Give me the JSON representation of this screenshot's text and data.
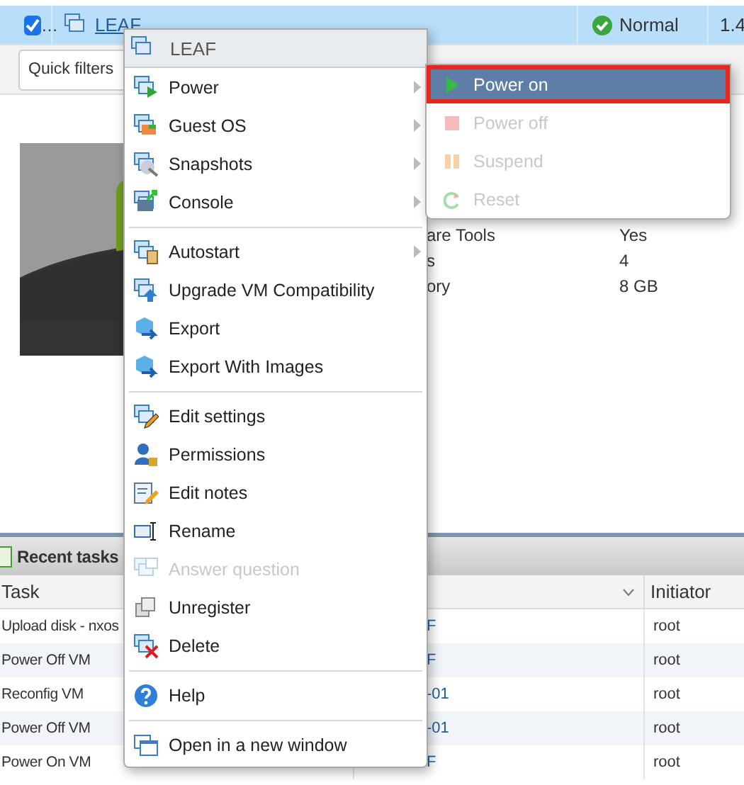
{
  "vm_row": {
    "checked": true,
    "overflow": "…",
    "name": "LEAF",
    "status": "Normal",
    "column_4": "1.4"
  },
  "toolbar": {
    "quick_filters": "Quick filters"
  },
  "properties": [
    {
      "label": "are Tools",
      "value": "Yes"
    },
    {
      "label": "s",
      "value": "4"
    },
    {
      "label": "ory",
      "value": "8 GB"
    }
  ],
  "recent_tasks": {
    "title": "Recent tasks",
    "columns": {
      "task": "Task",
      "initiator": "Initiator"
    },
    "rows": [
      {
        "task": "Upload disk - nxos",
        "target": "F",
        "initiator": "root"
      },
      {
        "task": "Power Off VM",
        "target": "F",
        "initiator": "root"
      },
      {
        "task": "Reconfig VM",
        "target": "-01",
        "initiator": "root"
      },
      {
        "task": "Power Off VM",
        "target": "-01",
        "initiator": "root"
      },
      {
        "task": "Power On VM",
        "target": "F",
        "initiator": "root"
      }
    ]
  },
  "context_menu": {
    "title": "LEAF",
    "groups": [
      [
        {
          "label": "Power",
          "submenu": true,
          "disabled": false
        },
        {
          "label": "Guest OS",
          "submenu": true,
          "disabled": false
        },
        {
          "label": "Snapshots",
          "submenu": true,
          "disabled": false
        },
        {
          "label": "Console",
          "submenu": true,
          "disabled": false
        }
      ],
      [
        {
          "label": "Autostart",
          "submenu": true,
          "disabled": false
        },
        {
          "label": "Upgrade VM Compatibility",
          "submenu": false,
          "disabled": false
        },
        {
          "label": "Export",
          "submenu": false,
          "disabled": false
        },
        {
          "label": "Export With Images",
          "submenu": false,
          "disabled": false
        }
      ],
      [
        {
          "label": "Edit settings",
          "submenu": false,
          "disabled": false
        },
        {
          "label": "Permissions",
          "submenu": false,
          "disabled": false
        },
        {
          "label": "Edit notes",
          "submenu": false,
          "disabled": false
        },
        {
          "label": "Rename",
          "submenu": false,
          "disabled": false
        },
        {
          "label": "Answer question",
          "submenu": false,
          "disabled": true
        },
        {
          "label": "Unregister",
          "submenu": false,
          "disabled": false
        },
        {
          "label": "Delete",
          "submenu": false,
          "disabled": false
        }
      ],
      [
        {
          "label": "Help",
          "submenu": false,
          "disabled": false
        }
      ],
      [
        {
          "label": "Open in a new window",
          "submenu": false,
          "disabled": false
        }
      ]
    ]
  },
  "power_submenu": {
    "items": [
      {
        "label": "Power on",
        "disabled": false,
        "selected": true,
        "outlined": true
      },
      {
        "label": "Power off",
        "disabled": true,
        "selected": false,
        "outlined": false
      },
      {
        "label": "Suspend",
        "disabled": true,
        "selected": false,
        "outlined": false
      },
      {
        "label": "Reset",
        "disabled": true,
        "selected": false,
        "outlined": false
      }
    ]
  }
}
